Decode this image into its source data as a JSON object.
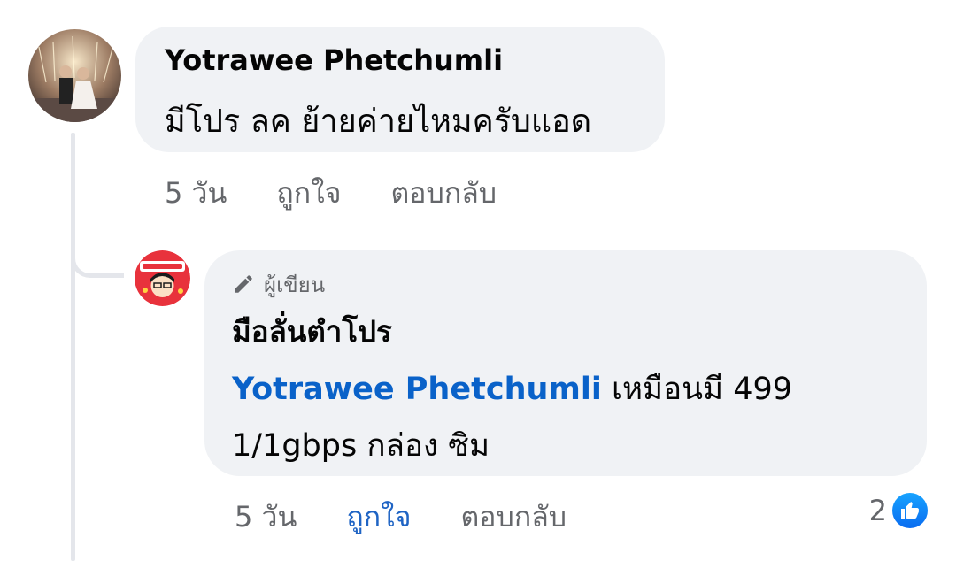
{
  "comment": {
    "author": "Yotrawee Phetchumli",
    "text": "มีโปร ลค ย้ายค่ายไหมครับแอด",
    "time": "5 วัน",
    "like_label": "ถูกใจ",
    "reply_label": "ตอบกลับ",
    "avatar_icon": "profile-photo"
  },
  "reply": {
    "badge_icon": "pencil-icon",
    "badge_label": "ผู้เขียน",
    "author": "มือลั่นตำโปร",
    "mention": "Yotrawee Phetchumli",
    "text_after_mention": " เหมือนมี 499 1/1gbps กล่อง ซิม",
    "time": "5 วัน",
    "like_label": "ถูกใจ",
    "reply_label": "ตอบกลับ",
    "reaction_count": "2",
    "reaction_icon": "thumbs-up-icon",
    "avatar_icon": "page-logo",
    "colors": {
      "mention": "#0a62c9",
      "liked": "#1f64c4",
      "reaction": "#0a6cf0"
    }
  }
}
